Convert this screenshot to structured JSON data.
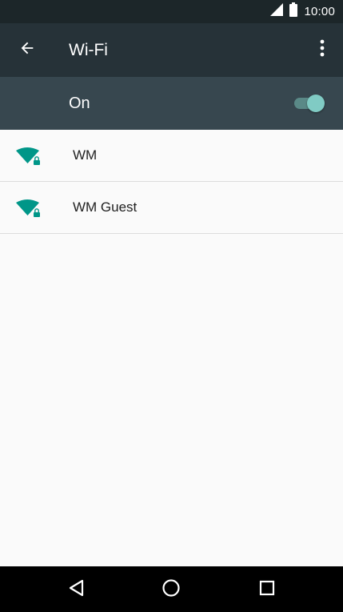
{
  "status_bar": {
    "time": "10:00",
    "icons": [
      "signal-icon",
      "battery-icon"
    ]
  },
  "app_bar": {
    "title": "Wi-Fi",
    "back_icon": "arrow-back-icon",
    "menu_icon": "more-vert-icon"
  },
  "master_switch": {
    "label": "On",
    "checked": true,
    "colors": {
      "thumb": "#80cbc4",
      "track": "#5a8987"
    }
  },
  "networks": [
    {
      "name": "WM",
      "icon": "wifi-lock-icon",
      "secured": true
    },
    {
      "name": "WM Guest",
      "icon": "wifi-lock-icon",
      "secured": true
    }
  ],
  "nav_bar": {
    "icons": [
      "back-triangle-icon",
      "home-circle-icon",
      "recents-square-icon"
    ]
  },
  "colors": {
    "status_bar": "#1c2629",
    "app_bar": "#263238",
    "switch_bar": "#37474f",
    "wifi_icon": "#009688",
    "background": "#fafafa"
  }
}
